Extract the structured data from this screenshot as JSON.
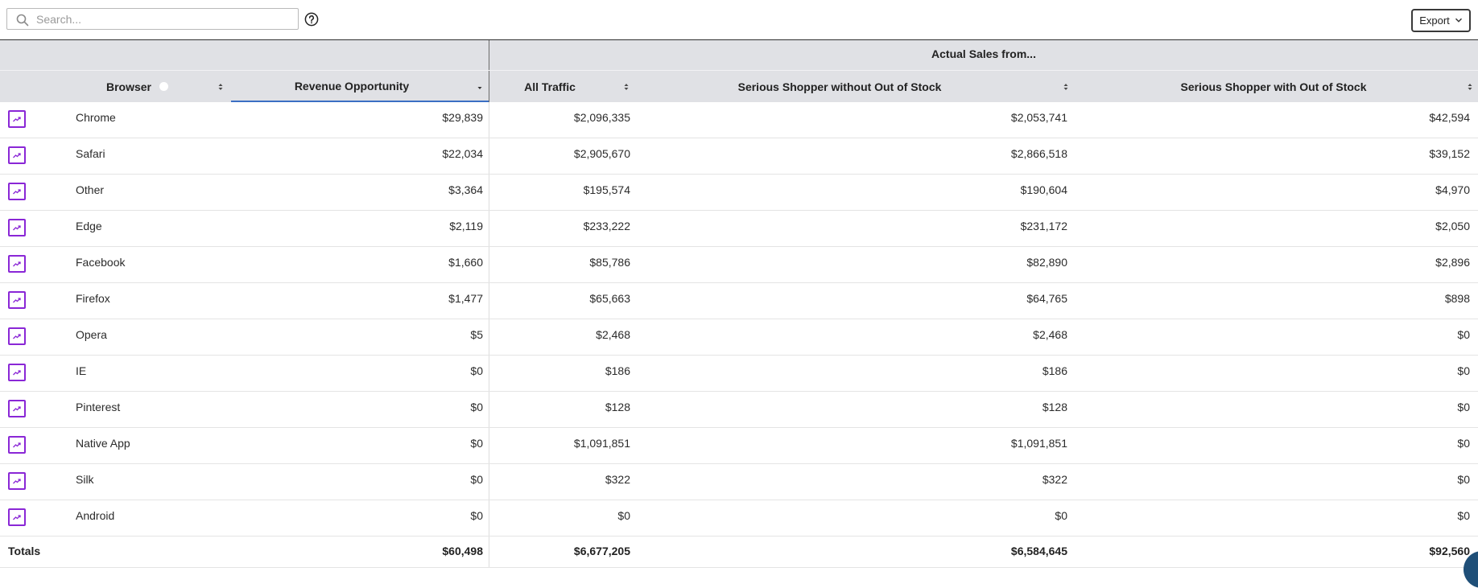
{
  "search": {
    "placeholder": "Search..."
  },
  "toolbar": {
    "export_label": "Export"
  },
  "table": {
    "group_header": "Actual Sales from...",
    "columns": {
      "browser": "Browser",
      "revenue": "Revenue Opportunity",
      "all_traffic": "All Traffic",
      "ss_without": "Serious Shopper without Out of Stock",
      "ss_with": "Serious Shopper with Out of Stock"
    },
    "rows": [
      {
        "name": "Chrome",
        "revenue": "$29,839",
        "all": "$2,096,335",
        "without": "$2,053,741",
        "with": "$42,594"
      },
      {
        "name": "Safari",
        "revenue": "$22,034",
        "all": "$2,905,670",
        "without": "$2,866,518",
        "with": "$39,152"
      },
      {
        "name": "Other",
        "revenue": "$3,364",
        "all": "$195,574",
        "without": "$190,604",
        "with": "$4,970"
      },
      {
        "name": "Edge",
        "revenue": "$2,119",
        "all": "$233,222",
        "without": "$231,172",
        "with": "$2,050"
      },
      {
        "name": "Facebook",
        "revenue": "$1,660",
        "all": "$85,786",
        "without": "$82,890",
        "with": "$2,896"
      },
      {
        "name": "Firefox",
        "revenue": "$1,477",
        "all": "$65,663",
        "without": "$64,765",
        "with": "$898"
      },
      {
        "name": "Opera",
        "revenue": "$5",
        "all": "$2,468",
        "without": "$2,468",
        "with": "$0"
      },
      {
        "name": "IE",
        "revenue": "$0",
        "all": "$186",
        "without": "$186",
        "with": "$0"
      },
      {
        "name": "Pinterest",
        "revenue": "$0",
        "all": "$128",
        "without": "$128",
        "with": "$0"
      },
      {
        "name": "Native App",
        "revenue": "$0",
        "all": "$1,091,851",
        "without": "$1,091,851",
        "with": "$0"
      },
      {
        "name": "Silk",
        "revenue": "$0",
        "all": "$322",
        "without": "$322",
        "with": "$0"
      },
      {
        "name": "Android",
        "revenue": "$0",
        "all": "$0",
        "without": "$0",
        "with": "$0"
      }
    ],
    "totals": {
      "label": "Totals",
      "revenue": "$60,498",
      "all": "$6,677,205",
      "without": "$6,584,645",
      "with": "$92,560"
    }
  },
  "colors": {
    "accent": "#8a27d6",
    "header_bg": "#e0e1e5",
    "sort_active": "#3b6fc4"
  },
  "icons": {
    "search": "search-icon",
    "help": "help-circle-icon",
    "export": "chevron-down-icon",
    "trend": "trend-chart-icon"
  }
}
